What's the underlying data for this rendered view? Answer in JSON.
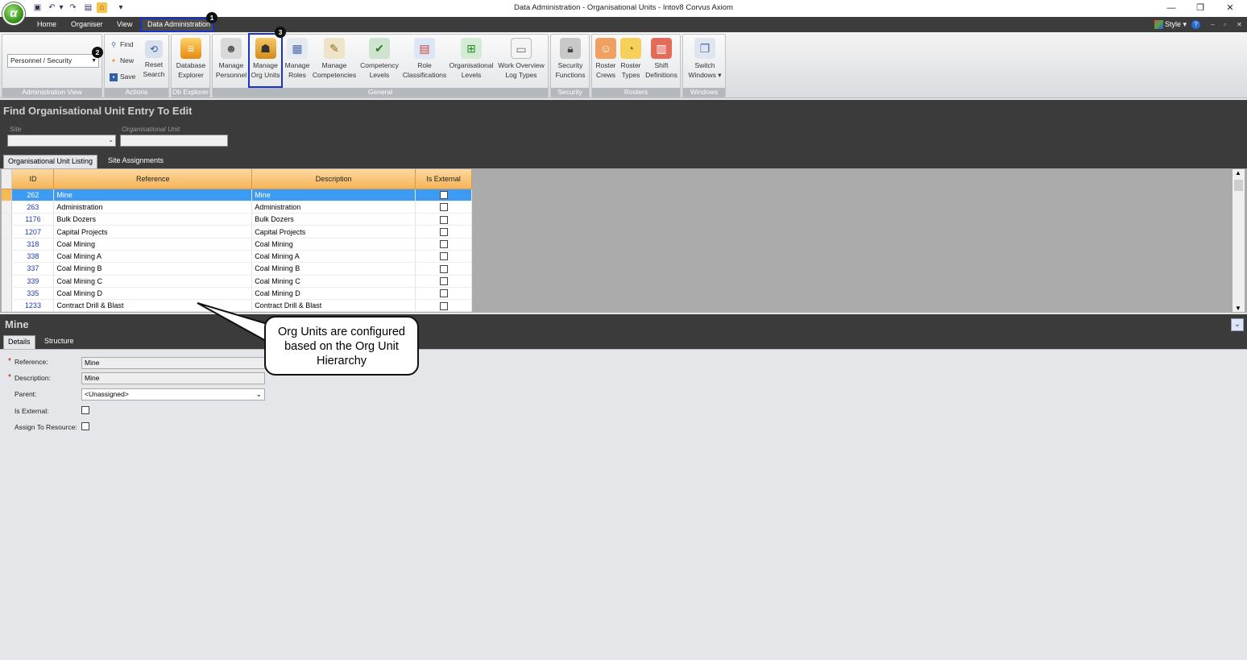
{
  "window": {
    "title": "Data Administration - Organisational Units - Intov8 Corvus Axiom",
    "orb_letter": "α"
  },
  "menu": {
    "items": [
      "Home",
      "Organiser",
      "View",
      "Data Administration"
    ],
    "style_label": "Style",
    "help_glyph": "?"
  },
  "ribbon": {
    "admin_view": {
      "value": "Personnel / Security",
      "group_label": "Administration View"
    },
    "actions": {
      "find": "Find",
      "new": "New",
      "save": "Save",
      "reset": "Reset",
      "reset2": "Search",
      "group_label": "Actions"
    },
    "db_explorer": {
      "label1": "Database",
      "label2": "Explorer",
      "group_label": "Db Explorer"
    },
    "general": {
      "group_label": "General",
      "buttons": [
        {
          "l1": "Manage",
          "l2": "Personnel"
        },
        {
          "l1": "Manage",
          "l2": "Org Units"
        },
        {
          "l1": "Manage",
          "l2": "Roles"
        },
        {
          "l1": "Manage",
          "l2": "Competencies"
        },
        {
          "l1": "Competency",
          "l2": "Levels"
        },
        {
          "l1": "Role",
          "l2": "Classifications"
        },
        {
          "l1": "Organisational",
          "l2": "Levels"
        },
        {
          "l1": "Work Overview",
          "l2": "Log Types"
        }
      ]
    },
    "security": {
      "l1": "Security",
      "l2": "Functions",
      "group_label": "Security"
    },
    "rosters": {
      "group_label": "Rosters",
      "buttons": [
        {
          "l1": "Roster",
          "l2": "Crews"
        },
        {
          "l1": "Roster",
          "l2": "Types"
        },
        {
          "l1": "Shift",
          "l2": "Definitions"
        }
      ]
    },
    "windows": {
      "l1": "Switch",
      "l2": "Windows ▾",
      "group_label": "Windows"
    }
  },
  "badges": {
    "one": "1",
    "two": "2",
    "three": "3"
  },
  "find": {
    "title": "Find Organisational Unit Entry To Edit",
    "site_label": "Site",
    "ou_label": "Organisational Unit"
  },
  "tabs": [
    "Organisational Unit Listing",
    "Site Assignments"
  ],
  "grid": {
    "columns": [
      "ID",
      "Reference",
      "Description",
      "Is External"
    ],
    "rows": [
      {
        "id": "262",
        "ref": "Mine",
        "desc": "Mine"
      },
      {
        "id": "263",
        "ref": "Administration",
        "desc": "Administration"
      },
      {
        "id": "1176",
        "ref": "Bulk Dozers",
        "desc": "Bulk Dozers"
      },
      {
        "id": "1207",
        "ref": "Capital Projects",
        "desc": "Capital Projects"
      },
      {
        "id": "318",
        "ref": "Coal Mining",
        "desc": "Coal Mining"
      },
      {
        "id": "338",
        "ref": "Coal Mining A",
        "desc": "Coal Mining A"
      },
      {
        "id": "337",
        "ref": "Coal Mining B",
        "desc": "Coal Mining B"
      },
      {
        "id": "339",
        "ref": "Coal Mining C",
        "desc": "Coal Mining C"
      },
      {
        "id": "335",
        "ref": "Coal Mining D",
        "desc": "Coal Mining D"
      },
      {
        "id": "1233",
        "ref": "Contract Drill & Blast",
        "desc": "Contract Drill & Blast"
      }
    ]
  },
  "detail": {
    "title": "Mine",
    "tabs": [
      "Details",
      "Structure"
    ],
    "reference_label": "Reference:",
    "reference_value": "Mine",
    "description_label": "Description:",
    "description_value": "Mine",
    "parent_label": "Parent:",
    "parent_value": "<Unassigned>",
    "external_label": "Is External:",
    "assign_label": "Assign To Resource:",
    "required_mark": "*"
  },
  "callout": {
    "text": "Org Units are configured based on the Org Unit Hierarchy"
  },
  "colors": {
    "accent_highlight": "#1a32c8",
    "selected_row": "#3d9bf3",
    "header_orange": "#f6b557"
  }
}
